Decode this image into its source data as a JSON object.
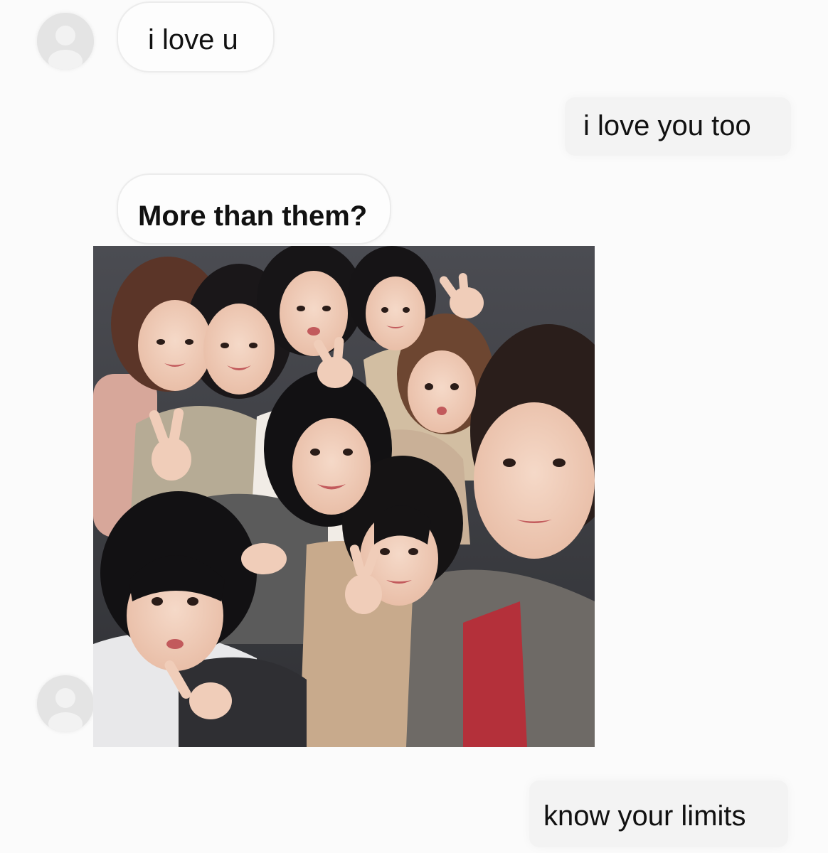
{
  "thread": {
    "messages": [
      {
        "direction": "incoming",
        "text": "i love u"
      },
      {
        "direction": "outgoing",
        "text": "i love you too"
      },
      {
        "direction": "incoming",
        "text": "More than them?"
      },
      {
        "direction": "incoming",
        "type": "image",
        "image_description": "group selfie photo"
      },
      {
        "direction": "outgoing",
        "text": "know your limits"
      }
    ]
  },
  "colors": {
    "background": "#fbfbfb",
    "incoming_bubble": "#fdfdfd",
    "outgoing_bubble": "#f3f3f3",
    "avatar": "#e6e6e6",
    "text": "#111111"
  },
  "icons": {
    "avatar": "default-user-avatar-icon"
  }
}
